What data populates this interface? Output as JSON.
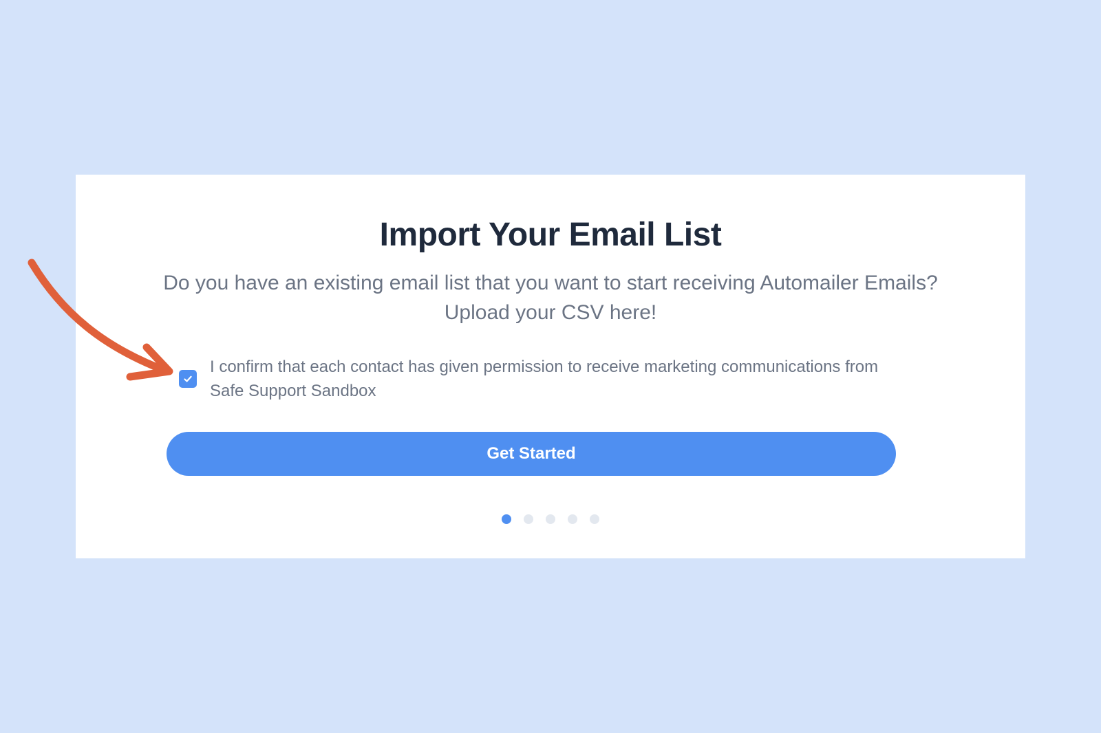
{
  "modal": {
    "title": "Import Your Email List",
    "description": "Do you have an existing email list that you want to start receiving Automailer Emails? Upload your CSV here!",
    "consent": {
      "checked": true,
      "label": "I confirm that each contact has given permission to receive marketing communications from Safe Support Sandbox"
    },
    "primary_button": "Get Started",
    "pagination": {
      "total": 5,
      "current": 1
    }
  },
  "annotation": {
    "icon": "arrow-icon",
    "color": "#e0603a"
  },
  "colors": {
    "background": "#d4e3fa",
    "accent": "#4f8ff1",
    "heading": "#1f2a3c",
    "body_text": "#6b7484"
  },
  "icons": {
    "checkbox": "checkmark-icon"
  }
}
